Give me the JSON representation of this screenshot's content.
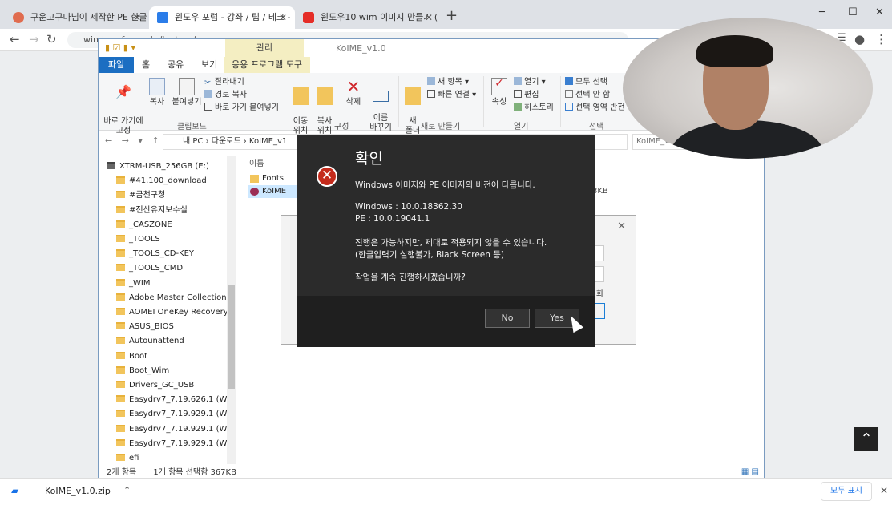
{
  "browser": {
    "tabs": [
      {
        "title": "구운고구마님이 제작한 PE 한글",
        "favicon_color": "#e06c4f"
      },
      {
        "title": "윈도우 포럼 - 강좌 / 팁 / 테크 -",
        "favicon_color": "#2b7de9"
      },
      {
        "title": "윈도우10 wim 이미지 만들기 (",
        "favicon_color": "#e52d27"
      }
    ],
    "new_tab": "+",
    "url": "windowsforum.kr/lecture/..."
  },
  "explorer": {
    "window_title": "KoIME_v1.0",
    "contextual_group": "관리",
    "ribbon_tabs": [
      "파일",
      "홈",
      "공유",
      "보기",
      "응용 프로그램 도구"
    ],
    "ribbon": {
      "pin": "바로 가기에\n고정",
      "copy": "복사",
      "paste": "붙여넣기",
      "cut": "잘라내기",
      "copy_path": "경로 복사",
      "paste_shortcut": "바로 가기 붙여넣기",
      "group_clipboard": "클립보드",
      "move_to": "이동\n위치",
      "copy_to": "복사\n위치",
      "delete": "삭제",
      "rename": "이름\n바꾸기",
      "group_organize": "구성",
      "new_folder": "새\n폴더",
      "new_item": "새 항목",
      "easy_access": "빠른 연결",
      "group_new": "새로 만들기",
      "properties": "속성",
      "open": "열기",
      "edit": "편집",
      "history": "히스토리",
      "group_open": "열기",
      "select_all": "모두 선택",
      "select_none": "선택 안 함",
      "invert_selection": "선택 영역 반전",
      "group_select": "선택"
    },
    "address": "내 PC  ›  다운로드  ›  KoIME_v1",
    "search_placeholder": "KoIME_v1",
    "nav_items": [
      "XTRM-USB_256GB (E:)",
      "#41.100_download",
      "#금천구청",
      "#전산유지보수실",
      "_CASZONE",
      "_TOOLS",
      "_TOOLS_CD-KEY",
      "_TOOLS_CMD",
      "_WIM",
      "Adobe Master Collection CC",
      "AOMEI OneKey Recovery Pro",
      "ASUS_BIOS",
      "Autounattend",
      "Boot",
      "Boot_Wim",
      "Drivers_GC_USB",
      "Easydrv7_7.19.626.1 (Win10.",
      "Easydrv7_7.19.929.1 (Win7.x",
      "Easydrv7_7.19.929.1 (Win7.x",
      "Easydrv7_7.19.929.1 (Win10.",
      "efi"
    ],
    "column_name": "이름",
    "files": [
      {
        "name": "Fonts",
        "selected": false
      },
      {
        "name": "KoIME",
        "selected": true
      }
    ],
    "file_size_fragment": "3KB",
    "status_count": "2개 항목",
    "status_selection": "1개 항목 선택함 367KB"
  },
  "background_dialog": {
    "text_fragment": "화"
  },
  "dialog": {
    "title": "확인",
    "message": "Windows 이미지와 PE 이미지의 버전이 다릅니다.",
    "windows_version": "Windows : 10.0.18362.30",
    "pe_version": "PE : 10.0.19041.1",
    "warning": "진행은 가능하지만, 제대로 적용되지 않을 수 있습니다.",
    "warning_detail": "(한글입력기 실행불가, Black Screen 등)",
    "question": "작업을 계속 진행하시겠습니까?",
    "no_label": "No",
    "yes_label": "Yes"
  },
  "downloads": {
    "file": "KoIME_v1.0.zip",
    "show_all": "모두 표시"
  }
}
